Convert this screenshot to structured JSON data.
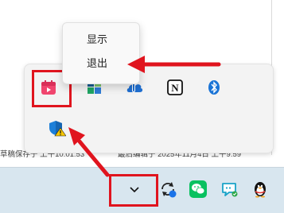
{
  "context_menu": {
    "items": [
      {
        "label": "显示"
      },
      {
        "label": "退出"
      }
    ]
  },
  "status_bar": {
    "draft_saved": "草稿保存于 上午10:01:53",
    "last_edited": "最后编辑于 2025年11月4日 上午9:59"
  },
  "tray_popup": {
    "icons": [
      {
        "name": "calendar-app-icon"
      },
      {
        "name": "colorful-app-icon"
      },
      {
        "name": "onedrive-app-icon"
      },
      {
        "name": "notion-icon",
        "glyph": "N"
      },
      {
        "name": "bluetooth-icon"
      },
      {
        "name": "windows-security-icon",
        "glyph": "!"
      }
    ]
  },
  "taskbar": {
    "icons": [
      {
        "name": "show-hidden-icons-chevron",
        "glyph": "⌄"
      },
      {
        "name": "sync-status-icon"
      },
      {
        "name": "wechat-icon"
      },
      {
        "name": "chat-bubble-icon"
      },
      {
        "name": "qq-penguin-icon"
      }
    ]
  },
  "colors": {
    "highlight": "#e0141e",
    "taskbar_bg": "#d8e6ef",
    "popup_bg": "#f3f3f3"
  }
}
